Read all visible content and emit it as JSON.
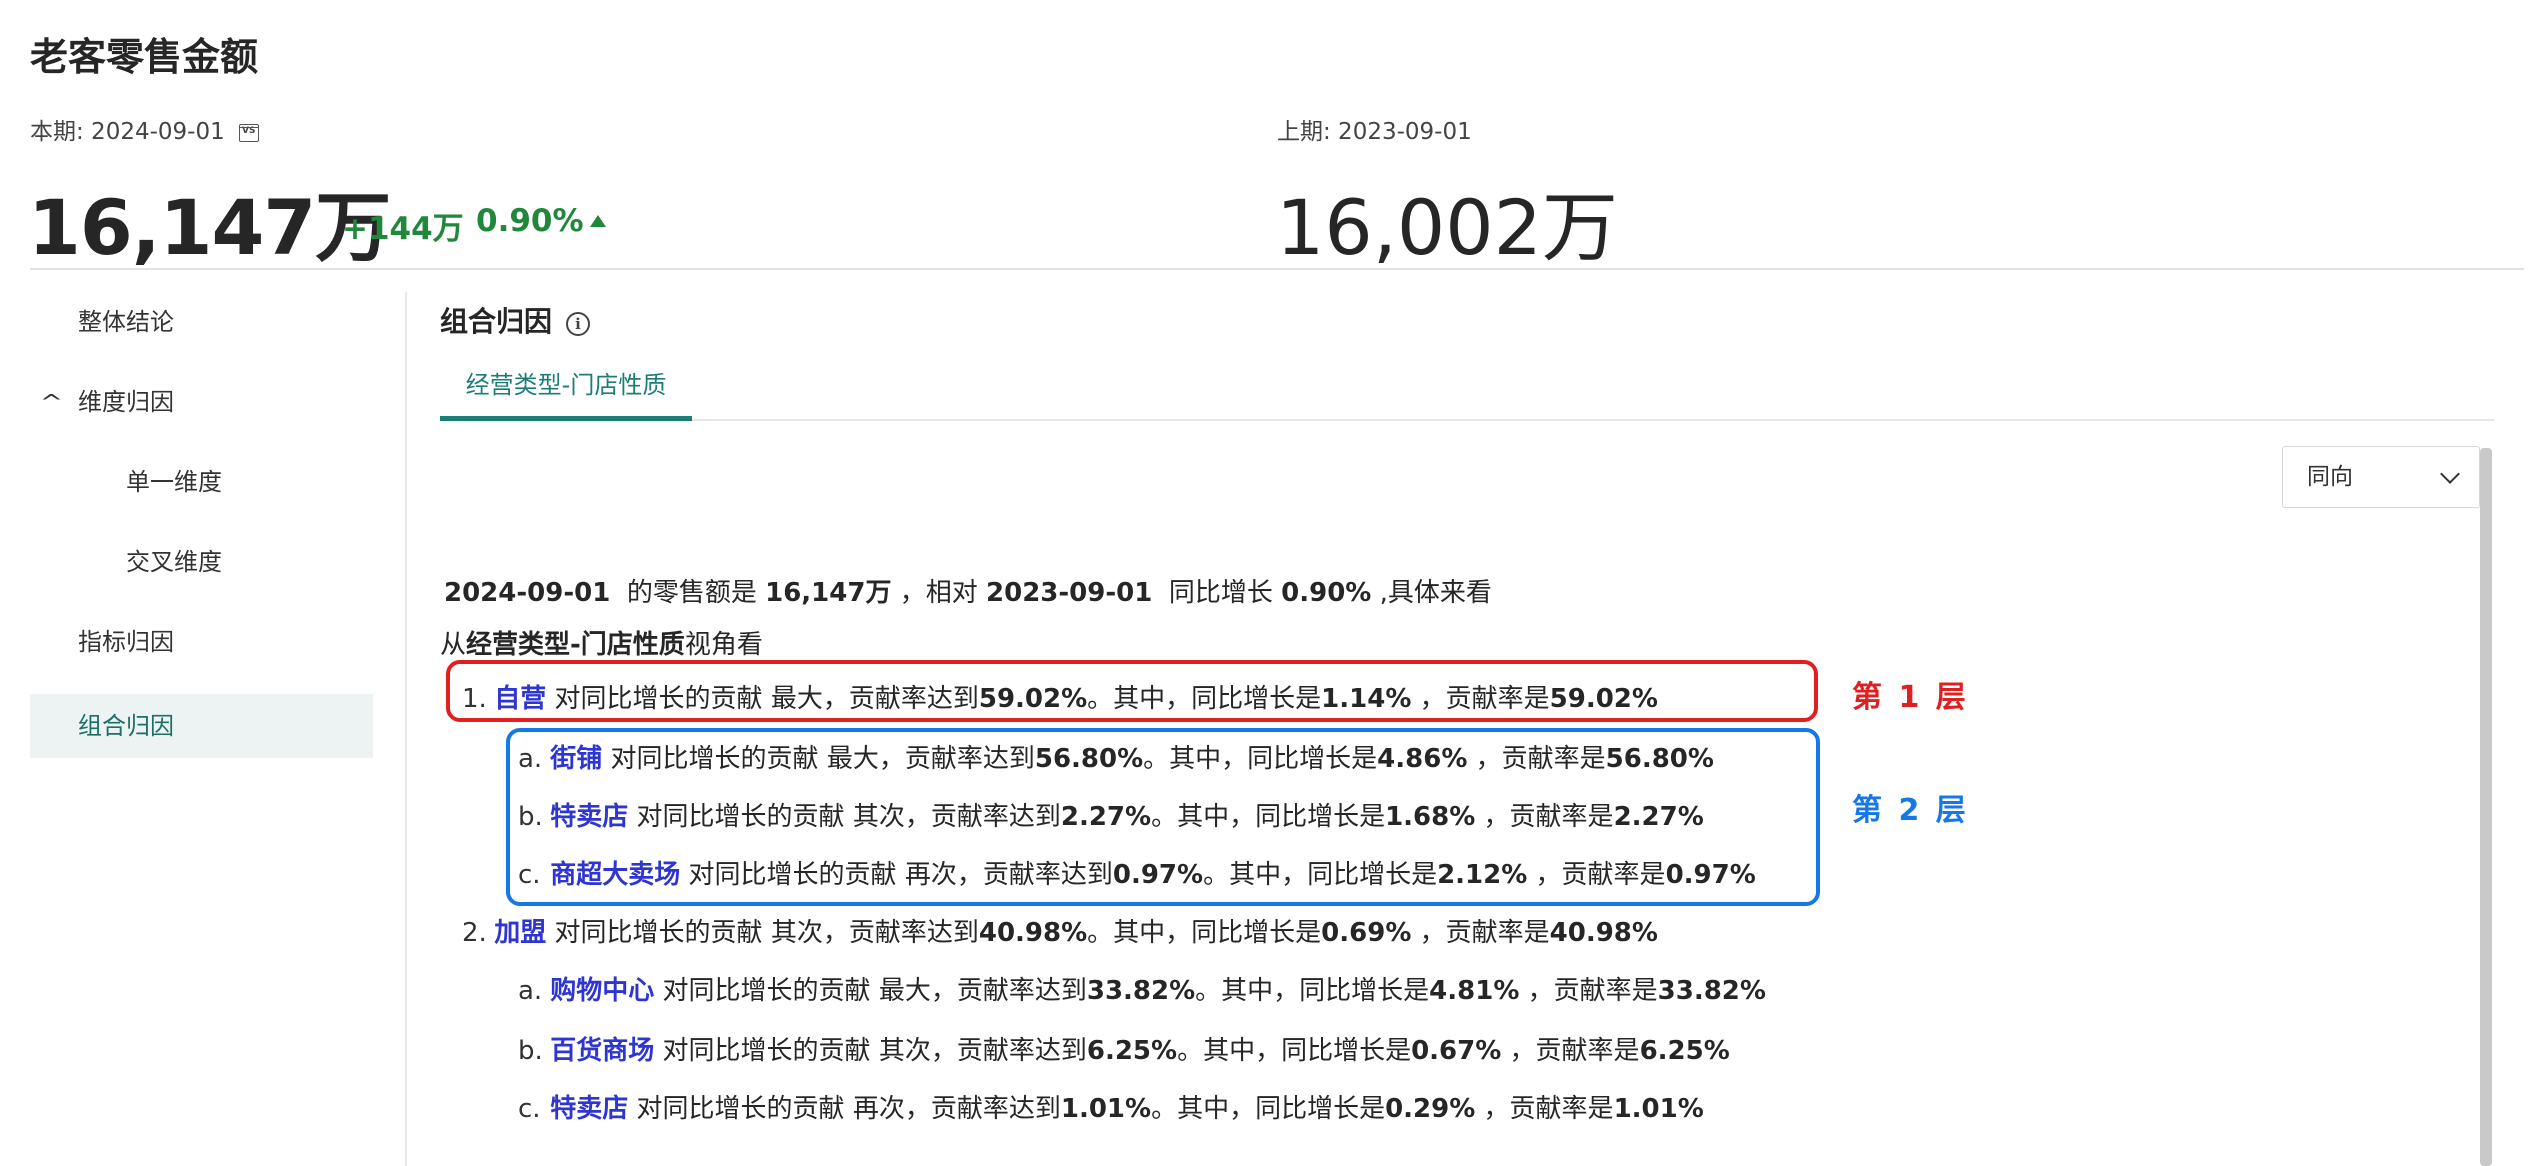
{
  "title": "老客零售金额",
  "current": {
    "label": "本期: 2024-09-01",
    "value": "16,147万",
    "delta": "+144万",
    "delta_pct": "0.90%"
  },
  "previous": {
    "label": "上期: 2023-09-01",
    "value": "16,002万"
  },
  "colors": {
    "positive": "#21873a",
    "accent": "#1b7d73",
    "highlight": "#2f35d0",
    "layer1": "#e02020",
    "layer2": "#1677e8"
  },
  "sidebar": {
    "items": [
      {
        "label": "整体结论"
      },
      {
        "label": "维度归因"
      },
      {
        "label": "单一维度"
      },
      {
        "label": "交叉维度"
      },
      {
        "label": "指标归因"
      },
      {
        "label": "组合归因"
      }
    ]
  },
  "main": {
    "section_title": "组合归因",
    "tab": "经营类型-门店性质",
    "select_value": "同向",
    "summary": {
      "date1": "2024-09-01",
      "t1": "的零售额是",
      "value": "16,147万",
      "t2": "，相对",
      "date2": "2023-09-01",
      "t3": "同比增长",
      "pct": "0.90%",
      "t4": ",具体来看"
    },
    "view": {
      "prefix": "从",
      "dim": "经营类型-门店性质",
      "suffix": "视角看"
    },
    "items": [
      {
        "idx": "1.",
        "name": "自营",
        "rank": "最大",
        "rate": "59.02%",
        "growth": "1.14%",
        "share": "59.02%"
      },
      {
        "idx": "a.",
        "name": "街铺",
        "rank": "最大",
        "rate": "56.80%",
        "growth": "4.86%",
        "share": "56.80%"
      },
      {
        "idx": "b.",
        "name": "特卖店",
        "rank": "其次",
        "rate": "2.27%",
        "growth": "1.68%",
        "share": "2.27%"
      },
      {
        "idx": "c.",
        "name": "商超大卖场",
        "rank": "再次",
        "rate": "0.97%",
        "growth": "2.12%",
        "share": "0.97%"
      },
      {
        "idx": "2.",
        "name": "加盟",
        "rank": "其次",
        "rate": "40.98%",
        "growth": "0.69%",
        "share": "40.98%"
      },
      {
        "idx": "a.",
        "name": "购物中心",
        "rank": "最大",
        "rate": "33.82%",
        "growth": "4.81%",
        "share": "33.82%"
      },
      {
        "idx": "b.",
        "name": "百货商场",
        "rank": "其次",
        "rate": "6.25%",
        "growth": "0.67%",
        "share": "6.25%"
      },
      {
        "idx": "c.",
        "name": "特卖店",
        "rank": "再次",
        "rate": "1.01%",
        "growth": "0.29%",
        "share": "1.01%"
      }
    ],
    "phrases": {
      "p1": "对同比增长的贡献",
      "p2": "，贡献率达到",
      "p3": "。其中，同比增长是",
      "p4": "，贡献率是"
    },
    "layer1": "第 1 层",
    "layer2": "第 2 层"
  }
}
